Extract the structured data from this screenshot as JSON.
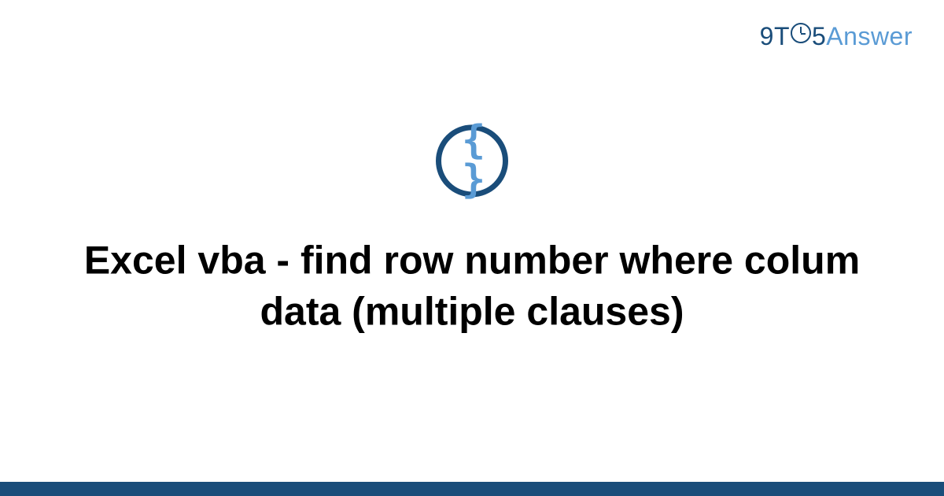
{
  "logo": {
    "part1": "9T",
    "part2": "5",
    "part3": "Answer"
  },
  "icon": {
    "glyph": "{ }",
    "name": "code-braces"
  },
  "title": "Excel vba - find row number where colum data (multiple clauses)",
  "colors": {
    "primary": "#1a4d7a",
    "accent": "#5a9bd5",
    "background": "#ffffff",
    "text": "#000000"
  }
}
